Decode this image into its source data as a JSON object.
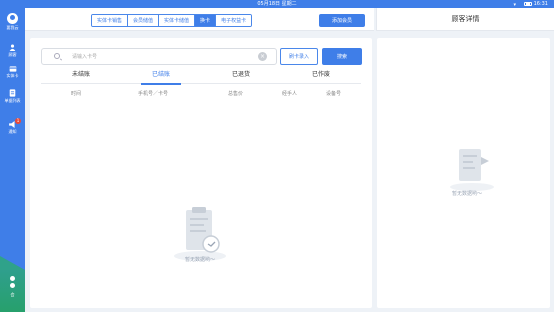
{
  "status_bar": {
    "date": "05月18日 星期二",
    "time": "16:31"
  },
  "sidebar": {
    "brand_label": "要我云",
    "items": [
      {
        "label": "顾客",
        "icon": "user-icon"
      },
      {
        "label": "实体卡",
        "icon": "card-icon"
      },
      {
        "label": "单据列表",
        "icon": "document-icon"
      },
      {
        "label": "通知",
        "icon": "speaker-icon",
        "badge": "1"
      }
    ],
    "bottom_label": "会"
  },
  "toolbar": {
    "tabs": [
      "实体卡销售",
      "会员储值",
      "实体卡储值",
      "换卡",
      "电子权益卡"
    ],
    "active_tab": "换卡",
    "add_member_label": "添加会员"
  },
  "detail_panel": {
    "title": "顾客详情",
    "empty_text": "暂无数据哟～"
  },
  "search": {
    "placeholder": "请输入卡号",
    "value": "",
    "swipe_label": "刷卡录入",
    "search_label": "搜索"
  },
  "order_tabs": [
    "未结账",
    "已结账",
    "已退货",
    "已作废"
  ],
  "active_order_tab": "已结账",
  "columns": [
    "时间",
    "手机号／卡号",
    "总售价",
    "经手人",
    "设备号"
  ],
  "empty_text": "暂无数据哟～",
  "colors": {
    "primary": "#3f7ee8",
    "accent_green": "#2fa28a",
    "badge_red": "#e84a3a"
  }
}
